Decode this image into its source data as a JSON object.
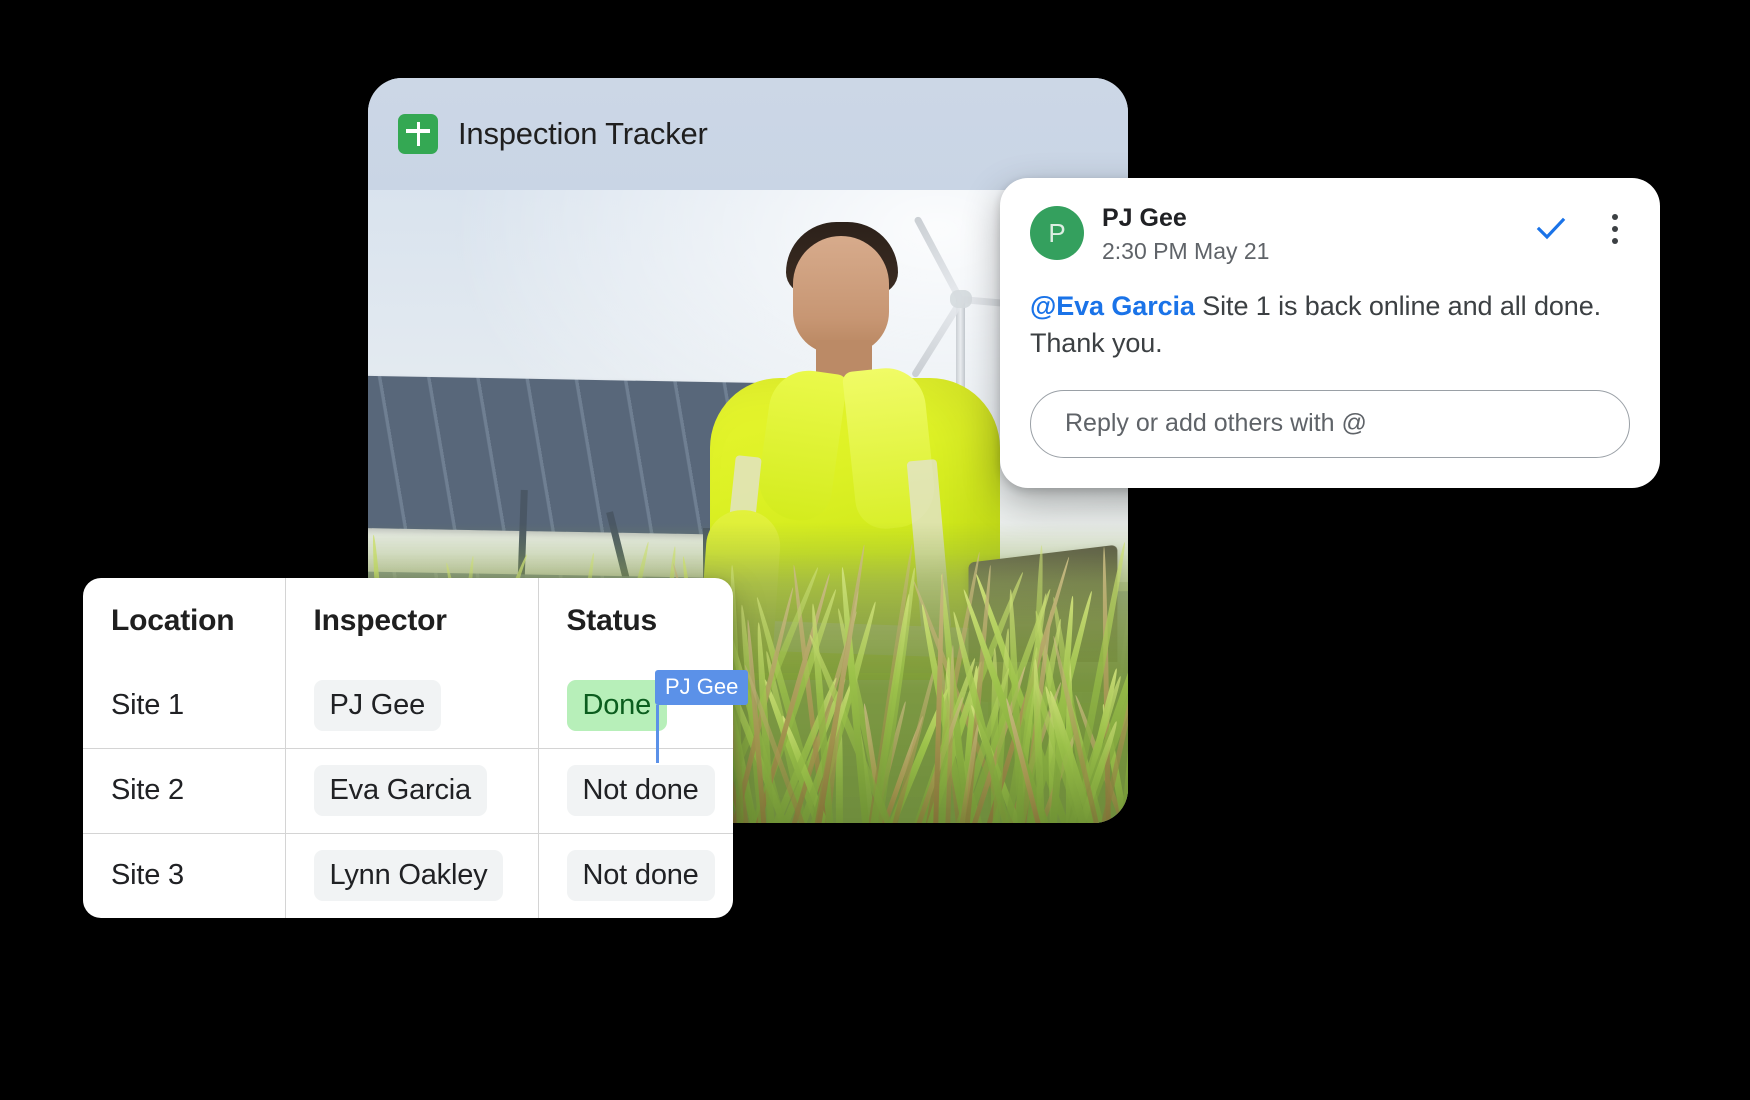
{
  "photo_card": {
    "app_icon": "google-sheets-icon",
    "title": "Inspection Tracker",
    "photo_alt": "Worker in hi-vis jacket using a laptop in a field with solar panels and a wind turbine"
  },
  "comment": {
    "avatar_initial": "P",
    "author": "PJ Gee",
    "timestamp": "2:30 PM May 21",
    "resolve_icon": "check-icon",
    "more_icon": "more-vertical-icon",
    "mention": "@Eva Garcia",
    "body": " Site 1 is back online and all done. Thank you.",
    "reply_placeholder": "Reply or add others with @",
    "reply_value": "",
    "accent_color": "#1a73e8",
    "avatar_color": "#34a05e"
  },
  "table": {
    "headers": [
      "Location",
      "Inspector",
      "Status"
    ],
    "rows": [
      {
        "location": "Site 1",
        "inspector": "PJ Gee",
        "status": "Done",
        "status_state": "done"
      },
      {
        "location": "Site 2",
        "inspector": "Eva Garcia",
        "status": "Not done",
        "status_state": "not-done"
      },
      {
        "location": "Site 3",
        "inspector": "Lynn Oakley",
        "status": "Not done",
        "status_state": "not-done"
      }
    ],
    "done_chip_color": "#b7efb9",
    "done_text_color": "#0b5d1e",
    "chip_color": "#f1f3f4"
  },
  "collaborator_cursor": {
    "label": "PJ Gee",
    "color": "#5b91e8"
  }
}
